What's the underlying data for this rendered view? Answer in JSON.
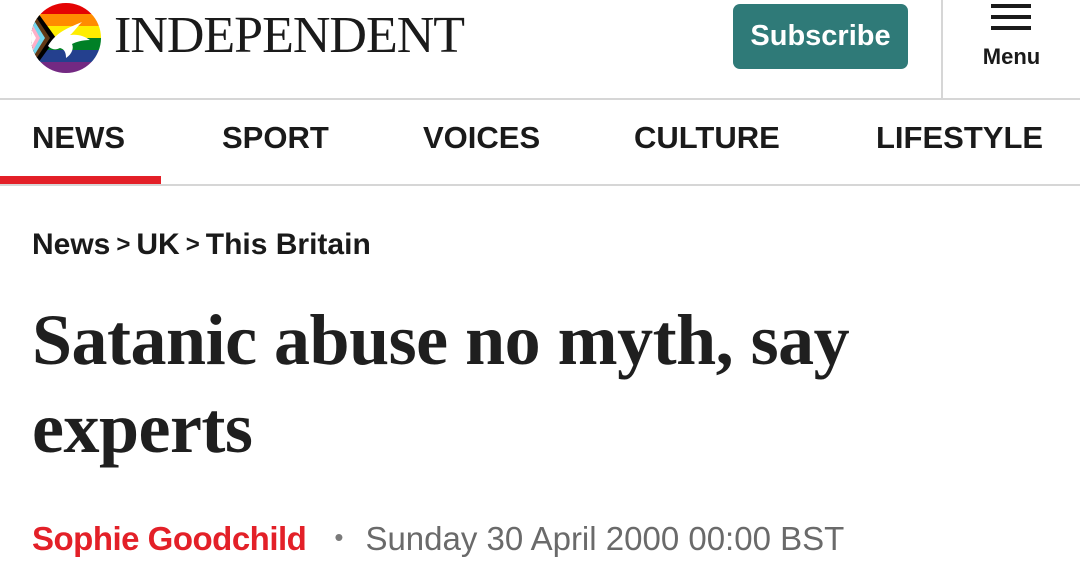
{
  "header": {
    "logo_icon": "eagle-pride-flag-icon",
    "wordmark": "INDEPENDENT",
    "subscribe_label": "Subscribe",
    "menu_label": "Menu",
    "menu_icon": "hamburger-icon",
    "subscribe_color": "#2f7a78"
  },
  "nav": {
    "items": [
      {
        "label": "NEWS",
        "active": true
      },
      {
        "label": "SPORT"
      },
      {
        "label": "VOICES"
      },
      {
        "label": "CULTURE"
      },
      {
        "label": "LIFESTYLE"
      }
    ],
    "active_color": "#e32028"
  },
  "breadcrumb": {
    "items": [
      "News",
      "UK",
      "This Britain"
    ],
    "separator": ">"
  },
  "article": {
    "headline": "Satanic abuse no myth, say experts",
    "author": "Sophie Goodchild",
    "separator": "•",
    "date": "Sunday 30 April 2000 00:00 BST",
    "author_color": "#e32028"
  }
}
